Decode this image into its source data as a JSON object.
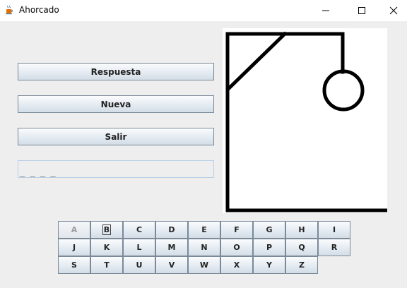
{
  "window": {
    "title": "Ahorcado",
    "icon": "java-cup-icon"
  },
  "controls": {
    "answer_label": "Respuesta",
    "new_label": "Nueva",
    "exit_label": "Salir"
  },
  "word_display": "_ _ _ _",
  "drawing": {
    "parts": [
      "gallows",
      "head"
    ]
  },
  "keyboard": {
    "rows": [
      [
        "A",
        "B",
        "C",
        "D",
        "E",
        "F",
        "G",
        "H",
        "I"
      ],
      [
        "J",
        "K",
        "L",
        "M",
        "N",
        "O",
        "P",
        "Q",
        "R"
      ],
      [
        "S",
        "T",
        "U",
        "V",
        "W",
        "X",
        "Y",
        "Z"
      ]
    ],
    "disabled": [
      "A"
    ],
    "focused": "B"
  }
}
